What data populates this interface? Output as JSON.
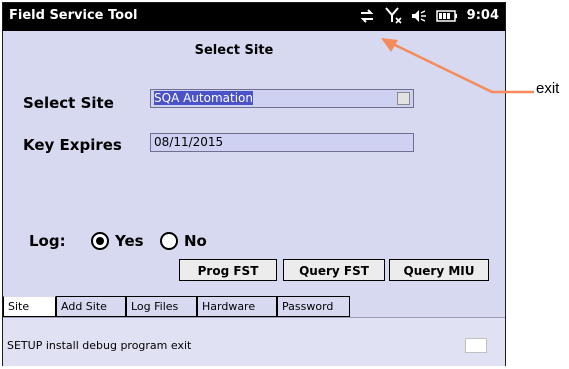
{
  "app_title": "Field Service Tool",
  "status_bar": {
    "time": "9:04"
  },
  "page_title": "Select Site",
  "select_site": {
    "label": "Select Site",
    "value": "SQA Automation"
  },
  "key_expires": {
    "label": "Key Expires",
    "value": "08/11/2015"
  },
  "log": {
    "label": "Log:",
    "options": [
      "Yes",
      "No"
    ],
    "selected": "Yes"
  },
  "buttons": {
    "prog": "Prog FST",
    "query_fst": "Query FST",
    "query_miu": "Query MIU"
  },
  "tabs": [
    "Site",
    "Add Site",
    "Log Files",
    "Hardware",
    "Password"
  ],
  "footer_text": "SETUP install debug program exit",
  "annotation": "exit",
  "colors": {
    "annotation_arrow": "#f58a5c",
    "background": "#d7d9f0",
    "selection": "#4a52c7"
  }
}
